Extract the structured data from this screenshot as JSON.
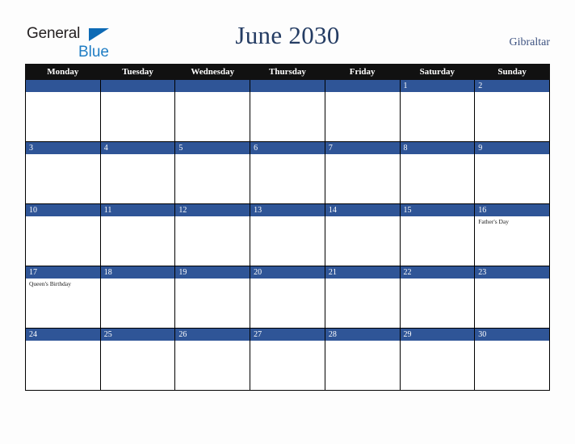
{
  "brand": {
    "name_part1": "General",
    "name_part2": "Blue",
    "triangle_color": "#0d6ab5",
    "text_color_1": "#231f20",
    "text_color_2": "#1f7dc4"
  },
  "header": {
    "title": "June 2030",
    "country": "Gibraltar",
    "title_color": "#243c63",
    "country_color": "#3d5280"
  },
  "calendar": {
    "header_bg": "#111111",
    "header_text_color": "#ffffff",
    "daynum_band_color": "#2f5597",
    "daynum_text_color": "#ffffff",
    "cell_bg": "#ffffff",
    "border_color": "#000000",
    "weekdays": [
      "Monday",
      "Tuesday",
      "Wednesday",
      "Thursday",
      "Friday",
      "Saturday",
      "Sunday"
    ],
    "weeks": [
      [
        {
          "day": "",
          "events": []
        },
        {
          "day": "",
          "events": []
        },
        {
          "day": "",
          "events": []
        },
        {
          "day": "",
          "events": []
        },
        {
          "day": "",
          "events": []
        },
        {
          "day": "1",
          "events": []
        },
        {
          "day": "2",
          "events": []
        }
      ],
      [
        {
          "day": "3",
          "events": []
        },
        {
          "day": "4",
          "events": []
        },
        {
          "day": "5",
          "events": []
        },
        {
          "day": "6",
          "events": []
        },
        {
          "day": "7",
          "events": []
        },
        {
          "day": "8",
          "events": []
        },
        {
          "day": "9",
          "events": []
        }
      ],
      [
        {
          "day": "10",
          "events": []
        },
        {
          "day": "11",
          "events": []
        },
        {
          "day": "12",
          "events": []
        },
        {
          "day": "13",
          "events": []
        },
        {
          "day": "14",
          "events": []
        },
        {
          "day": "15",
          "events": []
        },
        {
          "day": "16",
          "events": [
            "Father's Day"
          ]
        }
      ],
      [
        {
          "day": "17",
          "events": [
            "Queen's Birthday"
          ]
        },
        {
          "day": "18",
          "events": []
        },
        {
          "day": "19",
          "events": []
        },
        {
          "day": "20",
          "events": []
        },
        {
          "day": "21",
          "events": []
        },
        {
          "day": "22",
          "events": []
        },
        {
          "day": "23",
          "events": []
        }
      ],
      [
        {
          "day": "24",
          "events": []
        },
        {
          "day": "25",
          "events": []
        },
        {
          "day": "26",
          "events": []
        },
        {
          "day": "27",
          "events": []
        },
        {
          "day": "28",
          "events": []
        },
        {
          "day": "29",
          "events": []
        },
        {
          "day": "30",
          "events": []
        }
      ]
    ]
  }
}
